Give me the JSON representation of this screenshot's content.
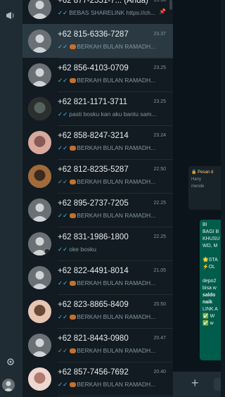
{
  "chats": [
    {
      "name": "+62 877-2551-7... (Anda)",
      "time": "15:56",
      "message": "BEBAS SHARELINK https://ch...",
      "tick": "blue",
      "pinned": true,
      "avatar": "default"
    },
    {
      "name": "+62 815-6336-7287",
      "time": "23.37",
      "message": "BERKAH BULAN RAMADH...",
      "tick": "blue",
      "avatar": "default",
      "selected": true
    },
    {
      "name": "+62 856-4103-0709",
      "time": "23.25",
      "message": "BERKAH BULAN RAMADH...",
      "tick": "blue",
      "avatar": "default"
    },
    {
      "name": "+62 821-1171-3711",
      "time": "23.25",
      "message": "pasti bosku kan aku bantu sam...",
      "tick": "blue",
      "avatar": "photo-dark"
    },
    {
      "name": "+62 858-8247-3214",
      "time": "23.24",
      "message": "BERKAH BULAN RAMADH...",
      "tick": "blue",
      "avatar": "photo-pink"
    },
    {
      "name": "+62 812-8235-5287",
      "time": "22.50",
      "message": "BERKAH BULAN RAMADH...",
      "tick": "grey",
      "avatar": "photo-warm"
    },
    {
      "name": "+62 895-2737-7205",
      "time": "22.25",
      "message": "BERKAH BULAN RAMADH...",
      "tick": "blue",
      "avatar": "default"
    },
    {
      "name": "+62 831-1986-1800",
      "time": "22.25",
      "message": "oke bosku",
      "tick": "blue",
      "avatar": "default-status"
    },
    {
      "name": "+62 822-4491-8014",
      "time": "21.05",
      "message": "BERKAH BULAN RAMADH...",
      "tick": "blue",
      "avatar": "default"
    },
    {
      "name": "+62 823-8865-8409",
      "time": "20.50",
      "message": "BERKAH BULAN RAMADH...",
      "tick": "blue",
      "avatar": "photo-baby"
    },
    {
      "name": "+62 821-8443-0980",
      "time": "20.47",
      "message": "BERKAH BULAN RAMADH...",
      "tick": "grey",
      "avatar": "default"
    },
    {
      "name": "+62 857-7456-7692",
      "time": "20.40",
      "message": "BERKAH BULAN RAMADH...",
      "tick": "blue",
      "avatar": "photo-baby2"
    }
  ],
  "notice": {
    "line1": "🔒 Pesan d",
    "line2": "Hany",
    "line3": "mende"
  },
  "bubble": {
    "l1": "BI",
    "l2": "BAGI B",
    "l3": "KHUSU",
    "l4": "WD, M",
    "l5": "🌟STA",
    "l6": "⚡OL",
    "l7": "depo2",
    "l8": "bisa w",
    "l9": "saldo",
    "l10": "naik",
    "l11": "LINK A",
    "l12": "✅ W",
    "l13": "✅ w"
  },
  "colors": {
    "accent": "#00a884",
    "selected": "#2a3942",
    "bubble": "#005c4b"
  }
}
